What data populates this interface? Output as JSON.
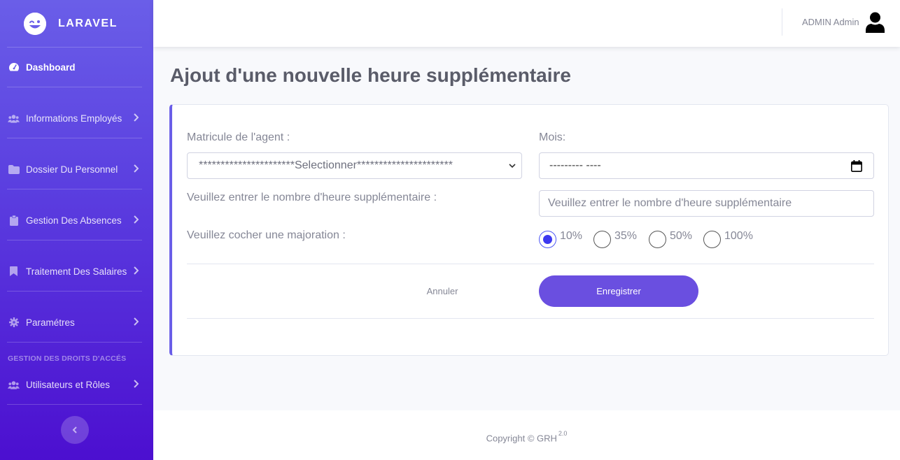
{
  "brand": {
    "name": "LARAVEL",
    "icon": "laugh-wink-icon"
  },
  "sidebar": {
    "items": [
      {
        "label": "Dashboard",
        "icon": "tachometer-icon",
        "active": true
      },
      {
        "label": "Informations Employés",
        "icon": "users-icon"
      },
      {
        "label": "Dossier Du Personnel",
        "icon": "folder-icon"
      },
      {
        "label": "Gestion Des Absences",
        "icon": "clipboard-icon"
      },
      {
        "label": "Traitement Des Salaires",
        "icon": "bookmark-icon"
      },
      {
        "label": "Paramétres",
        "icon": "cog-icon"
      },
      {
        "label": "Utilisateurs et Rôles",
        "icon": "users-icon"
      }
    ],
    "heading": "Gestion des droits d'accés",
    "toggle_icon": "chevron-left-icon"
  },
  "topbar": {
    "user_name": "ADMIN Admin",
    "avatar_icon": "user-icon"
  },
  "page": {
    "title": "Ajout d'une nouvelle heure supplémentaire"
  },
  "form": {
    "agent_label": "Matricule de l'agent :",
    "agent_select_value": "**********************Selectionner**********************",
    "month_label": "Mois:",
    "month_value": "--------- ----",
    "hours_label": "Veuillez entrer le nombre d'heure supplémentaire :",
    "hours_placeholder": "Veuillez entrer le nombre d'heure supplémentaire",
    "majoration_label": "Veuillez cocher une majoration :",
    "majorations": [
      {
        "label": "10%",
        "checked": true
      },
      {
        "label": "35%",
        "checked": false
      },
      {
        "label": "50%",
        "checked": false
      },
      {
        "label": "100%",
        "checked": false
      }
    ],
    "cancel_label": "Annuler",
    "save_label": "Enregistrer"
  },
  "footer": {
    "copyright": "Copyright © GRH",
    "version": "2.0"
  },
  "colors": {
    "sidebar_top": "#6a5ee8",
    "sidebar_bottom": "#4c0fd0",
    "primary": "#6a4fe0",
    "text_muted": "#858796"
  }
}
